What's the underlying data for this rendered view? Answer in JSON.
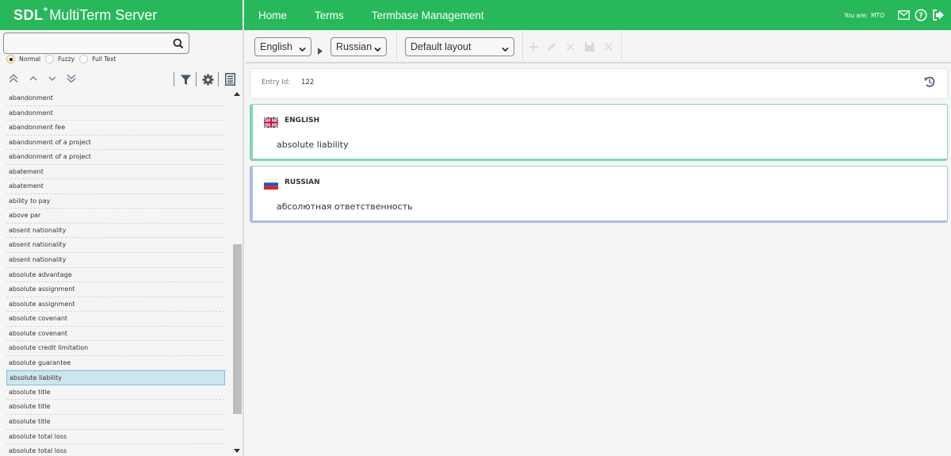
{
  "header": {
    "brand_sdl": "SDL",
    "brand_star": "*",
    "brand_product": "MultiTerm Server",
    "nav": [
      {
        "label": "Home"
      },
      {
        "label": "Terms"
      },
      {
        "label": "Termbase Management"
      }
    ],
    "you_are_label": "You are:",
    "user": "MTO",
    "icons": [
      "mail-icon",
      "help-icon",
      "logout-icon"
    ]
  },
  "search": {
    "value": "",
    "placeholder": "",
    "modes": [
      {
        "label": "Normal",
        "checked": true
      },
      {
        "label": "Fuzzy",
        "checked": false
      },
      {
        "label": "Full Text",
        "checked": false
      }
    ]
  },
  "term_list": {
    "selected_index": 19,
    "items": [
      "abandonment",
      "abandonment",
      "abandonment fee",
      "abandonment of a project",
      "abandonment of a project",
      "abatement",
      "abatement",
      "ability to pay",
      "above par",
      "absent nationality",
      "absent nationality",
      "absent nationality",
      "absolute advantage",
      "absolute assignment",
      "absolute assignment",
      "absolute covenant",
      "absolute covenant",
      "absolute credit limitation",
      "absolute guarantee",
      "absolute liability",
      "absolute title",
      "absolute title",
      "absolute title",
      "absolute total loss",
      "absolute total loss"
    ]
  },
  "toolbar": {
    "source_language": "English",
    "target_language": "Russian",
    "layout": "Default layout"
  },
  "entry": {
    "id_label": "Entry Id:",
    "id_value": "122",
    "languages": [
      {
        "name": "ENGLISH",
        "term": "absolute liability",
        "accent": "#7dd9b0"
      },
      {
        "name": "RUSSIAN",
        "term": "абсолютная ответственность",
        "accent": "#a9bde9"
      }
    ]
  },
  "colors": {
    "brand_green": "#27b85a",
    "selected_row": "#cce6ef"
  }
}
